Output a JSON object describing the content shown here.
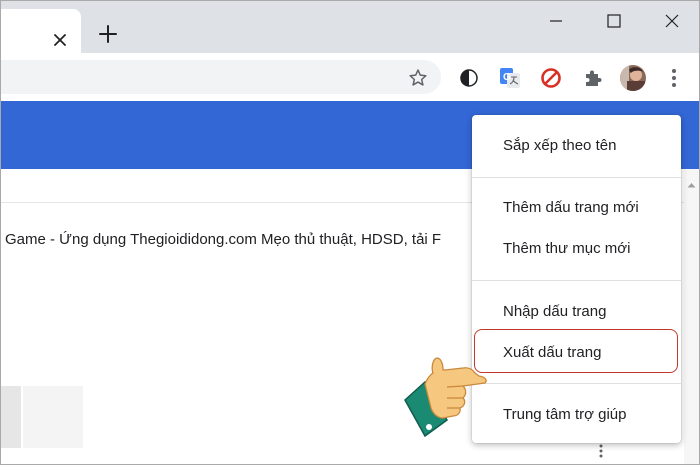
{
  "tab": {
    "close_icon": "close-icon",
    "new_tab_icon": "plus-icon"
  },
  "window_controls": {
    "minimize_icon": "minimize-icon",
    "maximize_icon": "maximize-icon",
    "close_icon": "close-icon"
  },
  "toolbar": {
    "bookmark_star_icon": "star-icon",
    "extensions": [
      "dark-mode-icon",
      "google-translate-icon",
      "block-icon",
      "puzzle-icon"
    ],
    "avatar_icon": "avatar",
    "menu_icon": "kebab-menu-icon"
  },
  "colors": {
    "header_blue": "#3367d6",
    "highlight_red": "#c0392b",
    "hand_skin": "#f6c77e",
    "cuff_teal": "#1a8a72"
  },
  "content": {
    "row_text": "Game - Ứng dụng Thegioididong.com Mẹo thủ thuật, HDSD, tải F"
  },
  "menu": {
    "items": [
      {
        "label": "Sắp xếp theo tên"
      },
      {
        "label": "Thêm dấu trang mới"
      },
      {
        "label": "Thêm thư mục mới"
      },
      {
        "label": "Nhập dấu trang"
      },
      {
        "label": "Xuất dấu trang"
      },
      {
        "label": "Trung tâm trợ giúp"
      }
    ]
  }
}
